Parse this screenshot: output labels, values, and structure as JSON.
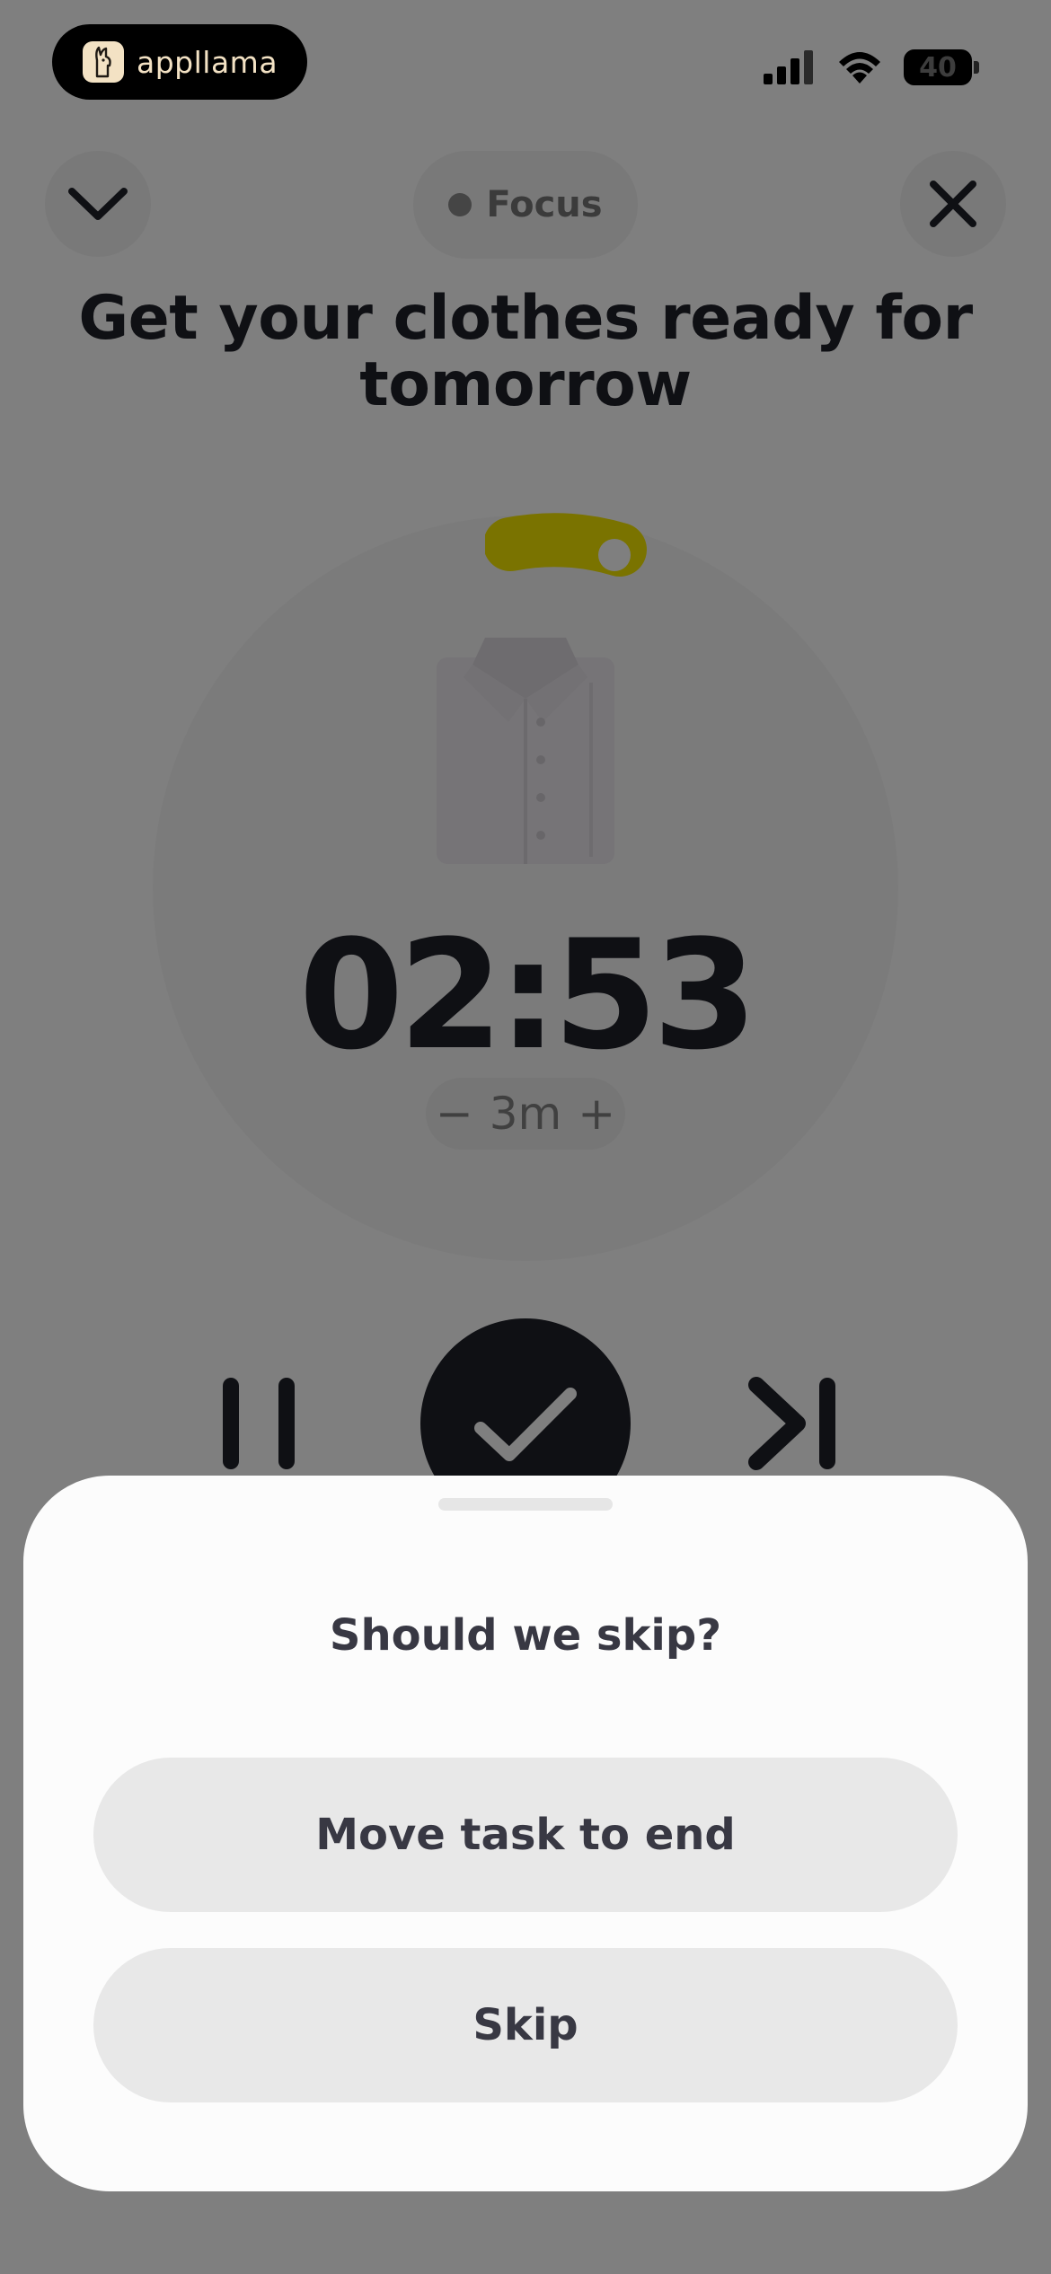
{
  "status_bar": {
    "app_name": "appllama",
    "battery_level": "40"
  },
  "header": {
    "focus_label": "Focus"
  },
  "task": {
    "title": "Get your clothes ready for tomorrow"
  },
  "timer": {
    "time": "02:53",
    "duration_label": "3m",
    "decrease_symbol": "−",
    "increase_symbol": "+",
    "accent_color": "#f5e600"
  },
  "sheet": {
    "title": "Should we skip?",
    "move_label": "Move task to end",
    "skip_label": "Skip"
  },
  "icons": {
    "collapse": "chevron-down-icon",
    "close": "close-icon",
    "task": "shirt-icon",
    "pause": "pause-icon",
    "done": "check-icon",
    "next": "skip-next-icon"
  }
}
